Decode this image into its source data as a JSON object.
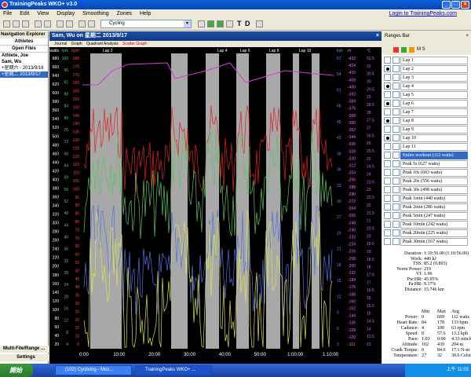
{
  "window": {
    "title": "TrainingPeaks WKO+ v3.0"
  },
  "menu": {
    "items": [
      "File",
      "Edit",
      "View",
      "Display",
      "Smoothing",
      "Zones",
      "Help"
    ],
    "login": "Login to TrainingPeaks.com"
  },
  "toolbar": {
    "sport": "Cycling",
    "symbols": [
      "T",
      "D"
    ]
  },
  "nav": {
    "title": "Navigation Explorer",
    "athletes_header": "Athletes",
    "open_files_header": "Open Files",
    "athlete_label": "Athlete, Joe",
    "athlete_name": "Sam, Wu",
    "files": [
      "+星期六 - 2013/9/16",
      "+星期二 2013/9/17"
    ],
    "bottom_tab": "Multi-File/Range ...",
    "settings": "Settings"
  },
  "chart": {
    "header": "Sam, Wu on 星期二 2013/9/17",
    "tabs": [
      "Journal",
      "Graph",
      "Quadrant Analysis",
      "Scatter Graph"
    ],
    "active_tab": "Scatter Graph",
    "left_axes": {
      "watts": {
        "label": "watts",
        "ticks": [
          680,
          660,
          640,
          620,
          600,
          580,
          560,
          540,
          520,
          500,
          480,
          460,
          440,
          420,
          400,
          380,
          360,
          340,
          320,
          300,
          280,
          260,
          240,
          220,
          200,
          180,
          160,
          140,
          120,
          100,
          80,
          60,
          40,
          20
        ]
      },
      "rpm": {
        "label": "rpm",
        "ticks": [
          100,
          96,
          92,
          88,
          84,
          80,
          76,
          72,
          68,
          64,
          60,
          56,
          52,
          48,
          44,
          40,
          36,
          32,
          28,
          24,
          20,
          16,
          12,
          8,
          4
        ]
      },
      "bpm": {
        "label": "bpm",
        "ticks": [
          180,
          175,
          170,
          165,
          160,
          155,
          150,
          145,
          140,
          135,
          130,
          125,
          120,
          115,
          110,
          105,
          100,
          95,
          90,
          85,
          80,
          75,
          70,
          65,
          60,
          55,
          50,
          45,
          40,
          35,
          30,
          25,
          20,
          15,
          10,
          5
        ]
      }
    },
    "right_axes": {
      "kph": {
        "label": "kph",
        "ticks": [
          57,
          54,
          51,
          48,
          45,
          42,
          39,
          36,
          33,
          30,
          27,
          24,
          21,
          18,
          15,
          12,
          9,
          6,
          3
        ]
      },
      "m": {
        "label": "m",
        "ticks": [
          -432,
          -424,
          -416,
          -408,
          -400,
          -392,
          -384,
          -376,
          -368,
          -360,
          -352,
          -344,
          -336,
          -328,
          -320,
          -312,
          -304,
          -296,
          -288,
          -280,
          -272,
          -264,
          -256,
          -248,
          -240,
          -232,
          -224,
          -216,
          -208,
          -200,
          -192,
          -184,
          -176,
          -168,
          -160,
          -152,
          -144,
          -136,
          -128,
          -120,
          -112
        ]
      },
      "deg": {
        "label": "°C",
        "ticks": [
          31.5,
          31,
          30.5,
          30,
          29.5,
          29,
          28.5,
          28,
          27.5,
          27,
          26.5,
          26,
          25.5,
          25,
          24.5,
          24,
          23.5,
          23,
          22.5,
          22,
          21.5,
          21,
          20.5,
          20,
          19.5,
          19,
          18.5,
          18,
          17.5,
          17,
          16.5,
          16,
          15.5,
          15,
          14.5,
          14,
          13.5,
          13
        ]
      }
    },
    "x_ticks": [
      "0:00",
      "10:00",
      "20:00",
      "30:00",
      "40:00",
      "50:00",
      "1:00:00",
      "1:10:00"
    ],
    "lap_labels": [
      "Lap 2",
      "Lap 4",
      "Lap 6",
      "Lap 8",
      "Lap 10"
    ],
    "colors": {
      "power": "#e0e050",
      "heart_rate": "#e02020",
      "cadence": "#60c060",
      "speed": "#5070e0",
      "altitude": "#d040d0",
      "temperature": "#c070f0",
      "lap_fill": "#a8a8a8"
    }
  },
  "ranges": {
    "title": "Ranges Bar",
    "items": [
      {
        "label": "Lap 1",
        "checked": false
      },
      {
        "label": "Lap 2",
        "checked": true
      },
      {
        "label": "Lap 3",
        "checked": false
      },
      {
        "label": "Lap 4",
        "checked": true
      },
      {
        "label": "Lap 5",
        "checked": false
      },
      {
        "label": "Lap 6",
        "checked": true
      },
      {
        "label": "Lap 7",
        "checked": false
      },
      {
        "label": "Lap 8",
        "checked": true
      },
      {
        "label": "Lap 9",
        "checked": false
      },
      {
        "label": "Lap 10",
        "checked": true
      },
      {
        "label": "Lap 11",
        "checked": false
      },
      {
        "label": "Entire workout (112 watts)",
        "checked": false,
        "selected": true
      },
      {
        "label": "Peak 5s (627 watts)",
        "checked": false
      },
      {
        "label": "Peak 10s (603 watts)",
        "checked": false
      },
      {
        "label": "Peak 20s (556 watts)",
        "checked": false
      },
      {
        "label": "Peak 30s (498 watts)",
        "checked": false
      },
      {
        "label": "Peak 1min (440 watts)",
        "checked": false
      },
      {
        "label": "Peak 2min (286 watts)",
        "checked": false
      },
      {
        "label": "Peak 5min (247 watts)",
        "checked": false
      },
      {
        "label": "Peak 10min (242 watts)",
        "checked": false
      },
      {
        "label": "Peak 20min (225 watts)",
        "checked": false
      },
      {
        "label": "Peak 30min (167 watts)",
        "checked": false
      }
    ]
  },
  "summary": [
    {
      "key": "Duration:",
      "value": "1:10:56.00 (1:10:56.00)"
    },
    {
      "key": "Work:",
      "value": "440 kJ"
    },
    {
      "key": "TSS:",
      "value": "85.2 (0.893)"
    },
    {
      "key": "Norm Power:",
      "value": "219"
    },
    {
      "key": "VI:",
      "value": "1.96"
    },
    {
      "key": "Pw:HR:",
      "value": "45.95%"
    },
    {
      "key": "Pa:HR:",
      "value": "9.17%"
    },
    {
      "key": "Distance:",
      "value": "15.746 km"
    },
    {
      "key": "Elev. Gain:",
      "value": "481 m"
    },
    {
      "key": "Elev. Loss:",
      "value": "484 m"
    },
    {
      "key": "Grade:",
      "value": "-0.0 % (-5 m)"
    }
  ],
  "stats": {
    "headers": [
      "Min",
      "Max",
      "Avg"
    ],
    "rows": [
      {
        "name": "Power:",
        "min": "0",
        "max": "669",
        "avg": "112 watts"
      },
      {
        "name": "Heart Rate:",
        "min": "84",
        "max": "178",
        "avg": "133 bpm"
      },
      {
        "name": "Cadence:",
        "min": "4",
        "max": "100",
        "avg": "63 rpm"
      },
      {
        "name": "Speed:",
        "min": "0",
        "max": "57.6",
        "avg": "13.2 kph"
      },
      {
        "name": "Pace:",
        "min": "1:03",
        "max": "0:00",
        "avg": "4:33 min/km"
      },
      {
        "name": "Altitude:",
        "min": "102",
        "max": "439",
        "avg": "204 m"
      },
      {
        "name": "Crank Torque:",
        "min": "0",
        "max": "84.6",
        "avg": "17.1 N-m"
      },
      {
        "name": "Temperature:",
        "min": "27",
        "max": "32",
        "avg": "30.6 Celsius"
      }
    ]
  },
  "taskbar": {
    "start": "開始",
    "tasks": [
      "(102) Cycliving - Moz...",
      "TrainingPeaks WKO+ ..."
    ],
    "clock": "上午 11:03"
  }
}
